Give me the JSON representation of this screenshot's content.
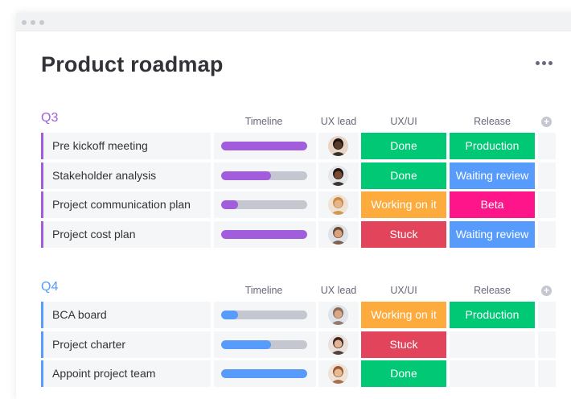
{
  "page": {
    "title": "Product roadmap"
  },
  "colors": {
    "purple": "#a25ddc",
    "blue": "#579bfc",
    "green": "#00c875",
    "orange": "#fdab3d",
    "red": "#e2445c",
    "pink": "#ff158a",
    "light_blue": "#579bfc",
    "text": "#323338",
    "muted": "#676879"
  },
  "columns": {
    "timeline": "Timeline",
    "ux_lead": "UX lead",
    "ux_ui": "UX/UI",
    "release": "Release"
  },
  "groups": [
    {
      "title": "Q3",
      "color": "#a25ddc",
      "rows": [
        {
          "name": "Pre kickoff meeting",
          "timeline_progress": 1.0,
          "ux_ui": "Done",
          "ux_ui_color": "#00c875",
          "release": "Production",
          "release_color": "#00c875",
          "avatar_icon": "user-avatar-icon"
        },
        {
          "name": "Stakeholder analysis",
          "timeline_progress": 0.58,
          "ux_ui": "Done",
          "ux_ui_color": "#00c875",
          "release": "Waiting review",
          "release_color": "#579bfc",
          "avatar_icon": "user-avatar-icon"
        },
        {
          "name": "Project communication plan",
          "timeline_progress": 0.2,
          "ux_ui": "Working on it",
          "ux_ui_color": "#fdab3d",
          "release": "Beta",
          "release_color": "#ff158a",
          "avatar_icon": "user-avatar-icon"
        },
        {
          "name": "Project cost plan",
          "timeline_progress": 1.0,
          "ux_ui": "Stuck",
          "ux_ui_color": "#e2445c",
          "release": "Waiting review",
          "release_color": "#579bfc",
          "avatar_icon": "user-avatar-icon"
        }
      ]
    },
    {
      "title": "Q4",
      "color": "#579bfc",
      "rows": [
        {
          "name": "BCA board",
          "timeline_progress": 0.2,
          "ux_ui": "Working on it",
          "ux_ui_color": "#fdab3d",
          "release": "Production",
          "release_color": "#00c875",
          "avatar_icon": "user-avatar-icon"
        },
        {
          "name": "Project charter",
          "timeline_progress": 0.58,
          "ux_ui": "Stuck",
          "ux_ui_color": "#e2445c",
          "release": "",
          "release_color": "",
          "avatar_icon": "user-avatar-icon"
        },
        {
          "name": "Appoint project team",
          "timeline_progress": 1.0,
          "ux_ui": "Done",
          "ux_ui_color": "#00c875",
          "release": "",
          "release_color": "",
          "avatar_icon": "user-avatar-icon"
        }
      ]
    }
  ]
}
